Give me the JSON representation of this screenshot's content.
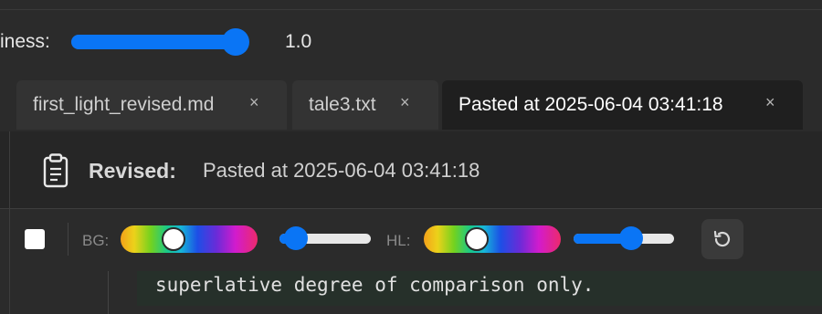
{
  "settings": {
    "slider_label": "iness:",
    "slider_value_text": "1.0",
    "slider_fraction": 1.0
  },
  "tabs": [
    {
      "label": "first_light_revised.md",
      "close": "×",
      "active": false
    },
    {
      "label": "tale3.txt",
      "close": "×",
      "active": false
    },
    {
      "label": "Pasted at 2025-06-04 03:41:18",
      "close": "×",
      "active": true
    }
  ],
  "header": {
    "icon": "clipboard-icon",
    "label": "Revised:",
    "title": "Pasted at 2025-06-04 03:41:18"
  },
  "toolbar": {
    "bg_label": "BG:",
    "hl_label": "HL:",
    "bg_hue_fraction": 0.36,
    "bg_slider_fraction": 0.12,
    "hl_hue_fraction": 0.36,
    "hl_slider_fraction": 0.58,
    "reset_icon": "reset-icon",
    "accent_color": "#0a75f5"
  },
  "editor": {
    "line_text": "superlative degree of comparison only."
  }
}
